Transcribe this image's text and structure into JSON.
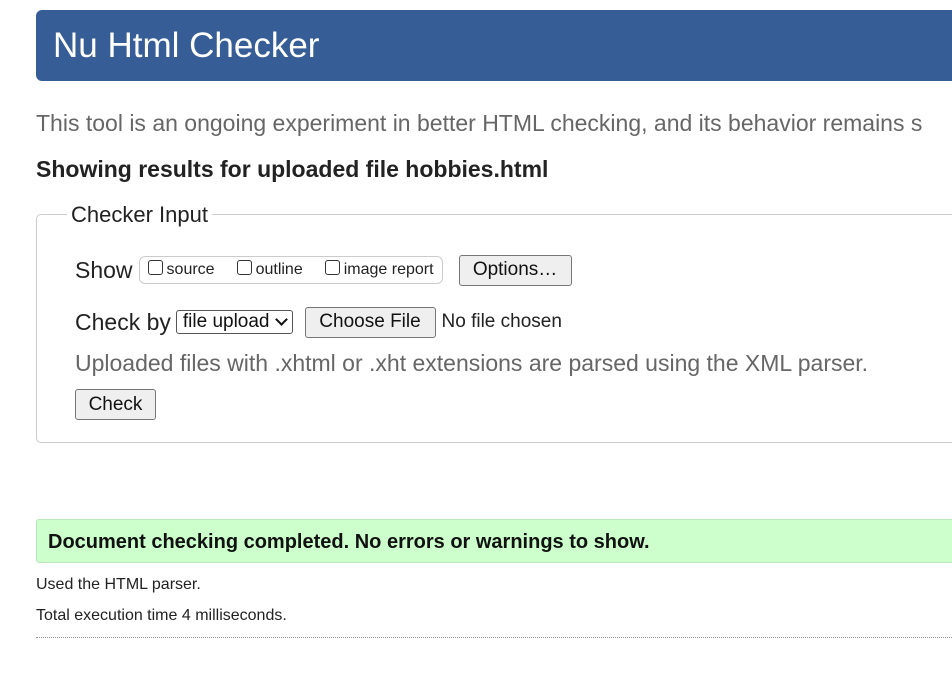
{
  "header": {
    "title": "Nu Html Checker"
  },
  "intro": {
    "text": "This tool is an ongoing experiment in better HTML checking, and its behavior remains s"
  },
  "results": {
    "title": "Showing results for uploaded file hobbies.html"
  },
  "checker_input": {
    "legend": "Checker Input",
    "show_label": "Show",
    "show_options": [
      {
        "label": "source",
        "checked": false
      },
      {
        "label": "outline",
        "checked": false
      },
      {
        "label": "image report",
        "checked": false
      }
    ],
    "options_button": "Options…",
    "check_by_label": "Check by",
    "check_by_selected": "file upload",
    "choose_file_button": "Choose File",
    "no_file_text": "No file chosen",
    "parser_note": "Uploaded files with .xhtml or .xht extensions are parsed using the XML parser.",
    "check_button": "Check"
  },
  "status": {
    "message": "Document checking completed. No errors or warnings to show.",
    "parser_used": "Used the HTML parser.",
    "execution_time": "Total execution time 4 milliseconds.",
    "color": "#ccffcc"
  },
  "colors": {
    "header_bg": "#365d95",
    "muted_text": "#666666"
  }
}
